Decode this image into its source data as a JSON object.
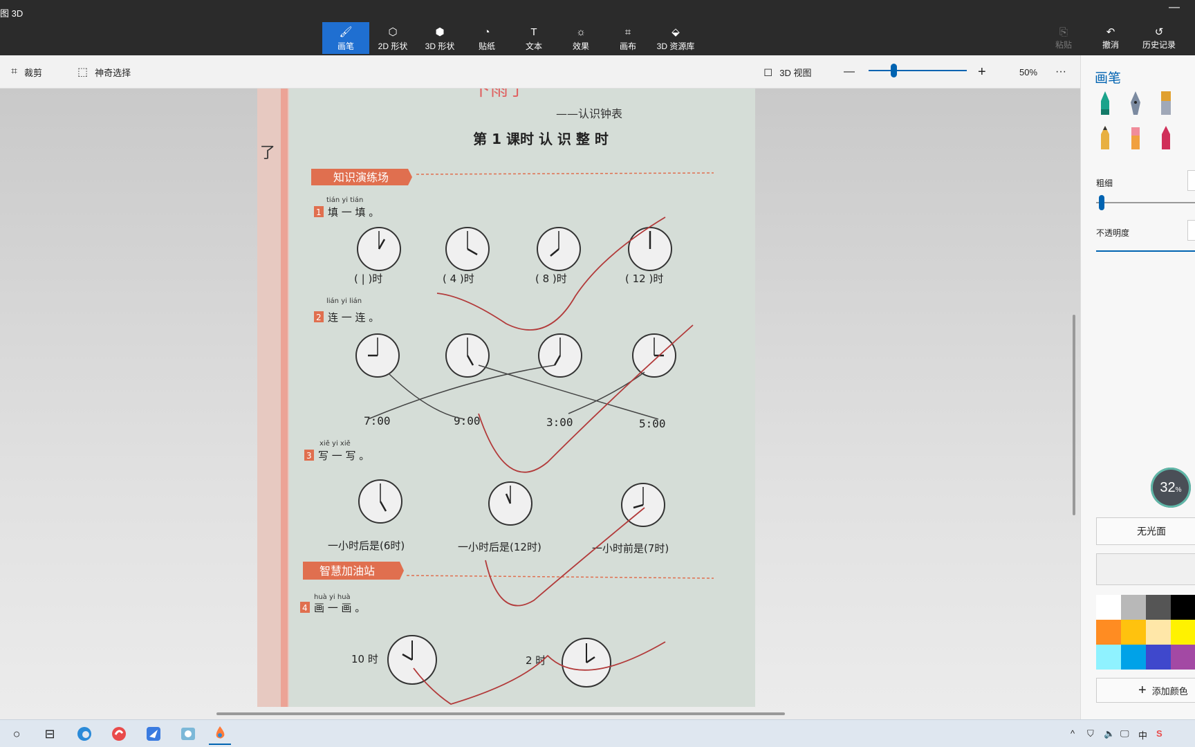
{
  "app": {
    "title": "图 3D",
    "minimize": "—"
  },
  "tools": [
    {
      "label": "画笔",
      "icon": "brush-icon",
      "glyph": "🖌"
    },
    {
      "label": "2D 形状",
      "icon": "shapes2d-icon",
      "glyph": "⬡"
    },
    {
      "label": "3D 形状",
      "icon": "cube-icon",
      "glyph": "⬢"
    },
    {
      "label": "贴纸",
      "icon": "sticker-icon",
      "glyph": "◔"
    },
    {
      "label": "文本",
      "icon": "text-icon",
      "glyph": "T"
    },
    {
      "label": "效果",
      "icon": "sun-icon",
      "glyph": "☼"
    },
    {
      "label": "画布",
      "icon": "canvas-icon",
      "glyph": "⌗"
    },
    {
      "label": "3D 资源库",
      "icon": "library-icon",
      "glyph": "⬙"
    }
  ],
  "right_tools": {
    "paste": "粘贴",
    "undo": "撤消",
    "history": "历史记录",
    "paste_glyph": "⎘",
    "undo_glyph": "↶",
    "history_glyph": "↺"
  },
  "toolbar2": {
    "crop": "裁剪",
    "magic_select": "神奇选择",
    "view3d": "3D 视图",
    "zoom_minus": "—",
    "zoom_plus": "+",
    "zoom": "50%",
    "more": "···",
    "crop_glyph": "⌗",
    "magic_glyph": "⬚",
    "view_glyph": "◻"
  },
  "zoom_level": 0.25,
  "panel": {
    "title": "画笔",
    "thickness": "粗细",
    "opacity": "不透明度",
    "finish": "无光面",
    "add_color": "添加颜色",
    "plus": "+"
  },
  "perf": {
    "value": "32",
    "unit": "%"
  },
  "worksheet": {
    "header": "下雨了",
    "subtitle": "——认识钟表",
    "lesson": "第 1 课时   认 识 整 时",
    "section1": "知识演练场",
    "q1_pinyin": "tián yi tián",
    "q1": "填 一 填 。",
    "q1_num": "1",
    "q1_blanks": [
      "( | )时",
      "( 4 )时",
      "( 8 )时",
      "( 12 )时"
    ],
    "q2_pinyin": "lián yi lián",
    "q2": "连 一 连 。",
    "q2_num": "2",
    "q2_times": [
      "7:00",
      "9:00",
      "3:00",
      "5:00"
    ],
    "q3_pinyin": "xiě yi xiě",
    "q3": "写 一 写 。",
    "q3_num": "3",
    "q3_items": [
      "一小时后是(6时)",
      "一小时后是(12时)",
      "一小时前是(7时)"
    ],
    "section2": "智慧加油站",
    "q4_pinyin": "huà yi huà",
    "q4": "画 一 画 。",
    "q4_num": "4",
    "q4_times": [
      "10 时",
      "2 时"
    ],
    "margin_text": "了"
  },
  "colors": [
    "#ffffff",
    "#b8b8b8",
    "#555555",
    "#000000",
    "#ff8c22",
    "#ffc20e",
    "#ffe7a8",
    "#fff200",
    "#8ff2ff",
    "#00a2e8",
    "#3f48cc",
    "#a349a4"
  ],
  "taskbar": {
    "start_glyph": "○",
    "task_glyph": "⊟",
    "tray": [
      "^",
      "⛉",
      "🔈",
      "🖵",
      "中",
      "S"
    ]
  }
}
